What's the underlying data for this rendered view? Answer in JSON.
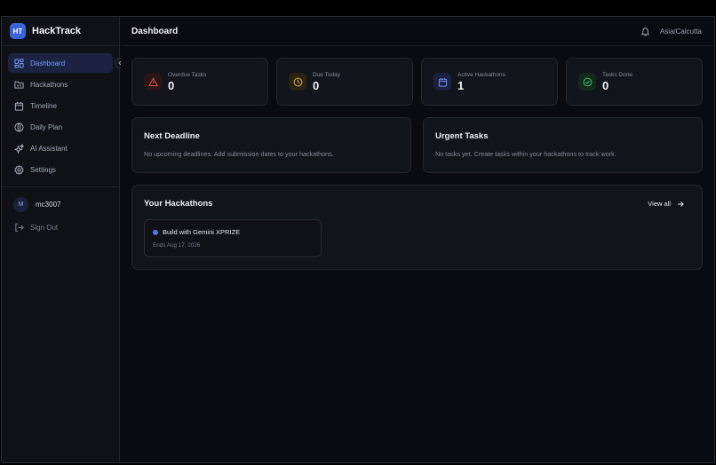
{
  "brand": {
    "logo_text": "HT",
    "name": "HackTrack"
  },
  "sidebar": {
    "items": [
      {
        "label": "Dashboard",
        "icon": "layout-dashboard-icon",
        "active": true
      },
      {
        "label": "Hackathons",
        "icon": "folder-code-icon"
      },
      {
        "label": "Timeline",
        "icon": "calendar-icon"
      },
      {
        "label": "Daily Plan",
        "icon": "compass-icon"
      },
      {
        "label": "AI Assistant",
        "icon": "sparkles-icon"
      },
      {
        "label": "Settings",
        "icon": "gear-icon"
      }
    ],
    "user": {
      "initial": "M",
      "name": "mc3007"
    },
    "signout_label": "Sign Out"
  },
  "header": {
    "title": "Dashboard",
    "timezone": "Asia/Calcutta"
  },
  "stats": [
    {
      "label": "Overdue Tasks",
      "value": "0",
      "icon": "alert-triangle-icon",
      "color": "#e0574f"
    },
    {
      "label": "Due Today",
      "value": "0",
      "icon": "clock-icon",
      "color": "#e0a93a"
    },
    {
      "label": "Active Hackathons",
      "value": "1",
      "icon": "calendar-icon",
      "color": "#6e8ef0"
    },
    {
      "label": "Tasks Done",
      "value": "0",
      "icon": "check-circle-icon",
      "color": "#3fbf6d"
    }
  ],
  "next_deadline": {
    "title": "Next Deadline",
    "text": "No upcoming deadlines. Add submission dates to your hackathons."
  },
  "urgent_tasks": {
    "title": "Urgent Tasks",
    "text": "No tasks yet. Create tasks within your hackathons to track work."
  },
  "hackathons": {
    "title": "Your Hackathons",
    "view_all_label": "View all",
    "items": [
      {
        "name": "Build with Gemini XPRIZE",
        "ends": "Ends Aug 17, 2026"
      }
    ]
  },
  "colors": {
    "accent": "#3b63d9",
    "background": "#0a0b10",
    "card": "#12141b"
  }
}
